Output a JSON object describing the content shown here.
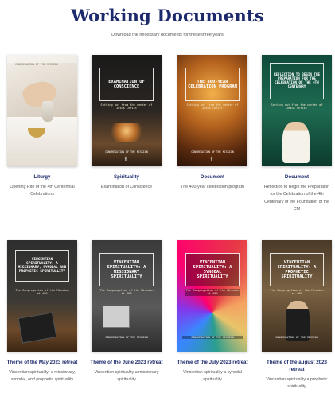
{
  "header": {
    "title": "Working Documents",
    "subtitle": "Download the necessary documents for these three years"
  },
  "cards": [
    {
      "title": "Liturgy",
      "description": "Opening Rite of the 4th Centennial Celebrations",
      "cover": {
        "banner": "CONGREGATION OF THE MISSION"
      }
    },
    {
      "title": "Spirituality",
      "description": "Examination of Conscience",
      "cover": {
        "heading": "EXAMINATION OF CONSCIENCE",
        "subheading": "Setting out from the center of Jesus Christ",
        "footer": "CONGREGATION OF THE MISSION"
      }
    },
    {
      "title": "Document",
      "description": "The 400-year celebration program",
      "cover": {
        "heading": "THE 400-YEAR CELEBRATION PROGRAM",
        "subheading": "Setting out from the center of Jesus Christ",
        "footer": "CONGREGATION OF THE MISSION"
      }
    },
    {
      "title": "Document",
      "description": "Reflection to Begin the Preparation for the Celebration of the 4th Centenary of the Foundation of the CM",
      "cover": {
        "heading": "REFLECTION TO BEGIN THE PREPARATION FOR THE CELEBRATION OF THE 4TH CENTENARY",
        "subheading": "Setting out from the center of Jesus Christ"
      }
    },
    {
      "title": "Theme of the May 2023 retreat",
      "description": "Vincentian spirituality: a missionary, synodal, and prophetic spirituality",
      "cover": {
        "heading": "VINCENTIAN SPIRITUALITY: A MISSIONARY, SYNODAL AND PROPHETIC SPIRITUALITY",
        "subheading": "The Congregation of the Mission at 400"
      }
    },
    {
      "title": "Theme of the June 2023 retreat",
      "description": "Vincentian spirituality a missionary spirituality",
      "cover": {
        "heading": "VINCENTIAN SPIRITUALITY: A MISSIONARY SPIRITUALITY",
        "subheading": "The Congregation of the Mission at 400",
        "footer": "CONGREGATION OF THE MISSION"
      }
    },
    {
      "title": "Theme of the July 2023 retreat",
      "description": "Vincentian spirituality a synodal spirituality",
      "cover": {
        "heading": "VINCENTIAN SPIRITUALITY: A SYNODAL SPIRITUALITY",
        "subheading": "The Congregation of the Mission at 400",
        "footer": "CONGREGATION OF THE MISSION"
      }
    },
    {
      "title": "Theme of the august 2023 retreat",
      "description": "Vincentian spirituality a prophetic spirituality",
      "cover": {
        "heading": "VINCENTIAN SPIRITUALITY: A PROPHETIC SPIRITUALITY",
        "subheading": "The Congregation of the Mission at 400",
        "footer": "CONGREGATION OF THE MISSION"
      }
    }
  ]
}
